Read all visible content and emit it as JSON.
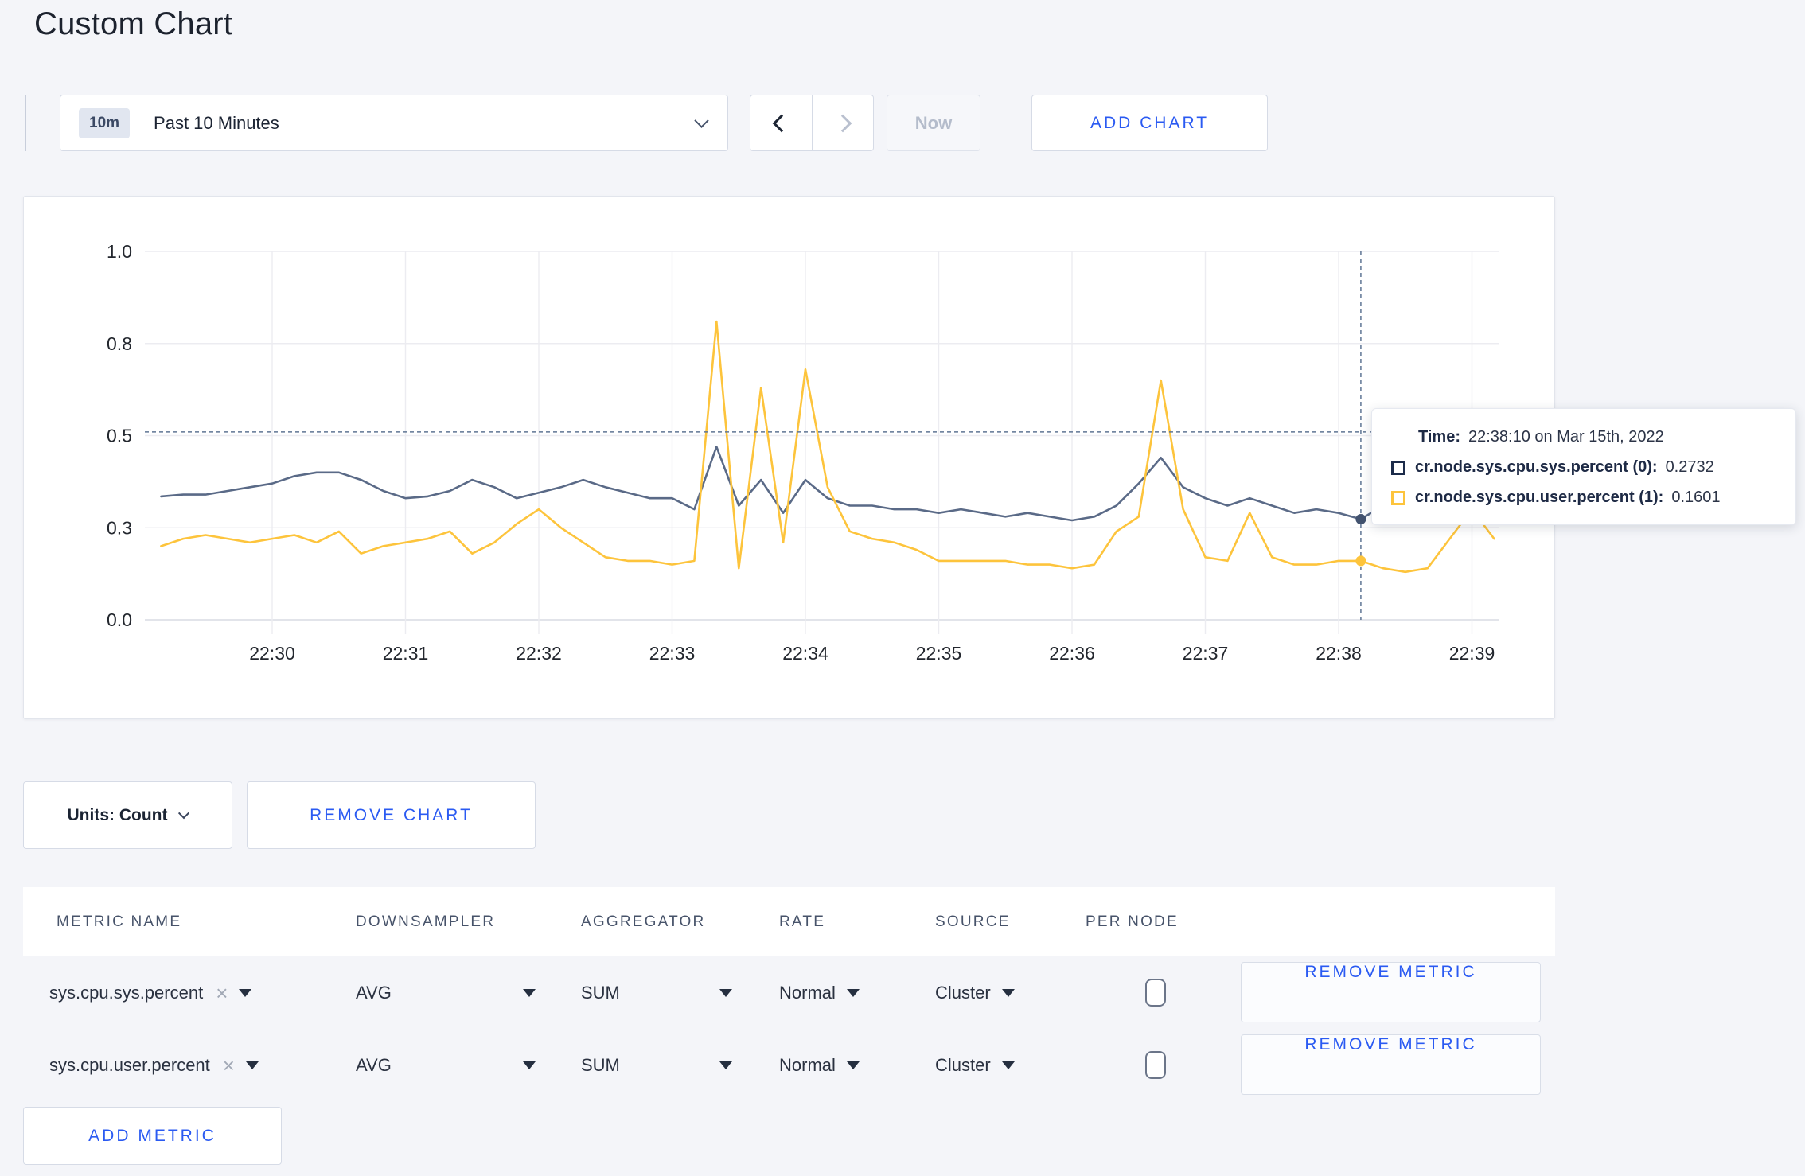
{
  "page": {
    "title": "Custom Chart",
    "background": "#f4f5f9",
    "accent_blue": "#2a5af2"
  },
  "icons": {
    "close": "×"
  },
  "toolbar": {
    "time_range": {
      "badge": "10m",
      "label": "Past 10 Minutes"
    },
    "now_label": "Now",
    "add_chart_label": "ADD CHART"
  },
  "tooltip": {
    "time_label": "Time:",
    "time_value": "22:38:10 on Mar 15th, 2022",
    "rows": [
      {
        "label": "cr.node.sys.cpu.sys.percent (0):",
        "value": "0.2732",
        "color": "#1c2b4a"
      },
      {
        "label": "cr.node.sys.cpu.user.percent (1):",
        "value": "0.1601",
        "color": "#fdc43c"
      }
    ]
  },
  "chart_controls": {
    "units_label": "Units: Count",
    "remove_chart_label": "REMOVE CHART"
  },
  "metrics_table": {
    "headers": [
      "METRIC NAME",
      "DOWNSAMPLER",
      "AGGREGATOR",
      "RATE",
      "SOURCE",
      "PER NODE"
    ],
    "rows": [
      {
        "metric": "sys.cpu.sys.percent",
        "downsampler": "AVG",
        "aggregator": "SUM",
        "rate": "Normal",
        "source": "Cluster",
        "per_node": false,
        "remove_label": "REMOVE METRIC"
      },
      {
        "metric": "sys.cpu.user.percent",
        "downsampler": "AVG",
        "aggregator": "SUM",
        "rate": "Normal",
        "source": "Cluster",
        "per_node": false,
        "remove_label": "REMOVE METRIC"
      }
    ],
    "add_metric_label": "ADD METRIC"
  },
  "chart_data": {
    "type": "line",
    "title": "",
    "xlabel": "",
    "ylabel": "",
    "ylim": [
      0,
      1
    ],
    "grid": true,
    "legend_position": "tooltip",
    "start_time": "22:29:10",
    "interval_seconds": 10,
    "x_ticks": [
      "22:30",
      "22:31",
      "22:32",
      "22:33",
      "22:34",
      "22:35",
      "22:36",
      "22:37",
      "22:38",
      "22:39"
    ],
    "y_ticks": [
      {
        "label": "1.0",
        "value": 1.0
      },
      {
        "label": "0.8",
        "value": 0.75
      },
      {
        "label": "0.5",
        "value": 0.5
      },
      {
        "label": "0.3",
        "value": 0.25
      },
      {
        "label": "0.0",
        "value": 0.0
      }
    ],
    "series": [
      {
        "name": "cr.node.sys.cpu.sys.percent",
        "color": "#5a6a87",
        "values": [
          0.335,
          0.34,
          0.34,
          0.35,
          0.36,
          0.37,
          0.39,
          0.4,
          0.4,
          0.38,
          0.35,
          0.33,
          0.335,
          0.35,
          0.38,
          0.36,
          0.33,
          0.345,
          0.36,
          0.38,
          0.36,
          0.345,
          0.33,
          0.33,
          0.3,
          0.47,
          0.31,
          0.38,
          0.29,
          0.38,
          0.33,
          0.31,
          0.31,
          0.3,
          0.3,
          0.29,
          0.3,
          0.29,
          0.28,
          0.29,
          0.28,
          0.27,
          0.28,
          0.31,
          0.37,
          0.44,
          0.36,
          0.33,
          0.31,
          0.33,
          0.31,
          0.29,
          0.3,
          0.29,
          0.2732,
          0.31,
          0.3,
          0.3,
          0.29,
          0.3,
          0.31
        ]
      },
      {
        "name": "cr.node.sys.cpu.user.percent",
        "color": "#fdc43c",
        "values": [
          0.2,
          0.22,
          0.23,
          0.22,
          0.21,
          0.22,
          0.23,
          0.21,
          0.24,
          0.18,
          0.2,
          0.21,
          0.22,
          0.24,
          0.18,
          0.21,
          0.26,
          0.3,
          0.25,
          0.21,
          0.17,
          0.16,
          0.16,
          0.15,
          0.16,
          0.81,
          0.14,
          0.63,
          0.21,
          0.68,
          0.36,
          0.24,
          0.22,
          0.21,
          0.19,
          0.16,
          0.16,
          0.16,
          0.16,
          0.15,
          0.15,
          0.14,
          0.15,
          0.24,
          0.28,
          0.65,
          0.3,
          0.17,
          0.16,
          0.29,
          0.17,
          0.15,
          0.15,
          0.16,
          0.1601,
          0.14,
          0.13,
          0.14,
          0.22,
          0.3,
          0.22
        ]
      }
    ],
    "crosshair": {
      "time": "22:38:10",
      "index": 54,
      "y_value": 0.51
    },
    "highlighted": [
      {
        "series": 0,
        "value": 0.2732,
        "dot_color": "#43536f"
      },
      {
        "series": 1,
        "value": 0.1601,
        "dot_color": "#fdc43c"
      }
    ]
  }
}
